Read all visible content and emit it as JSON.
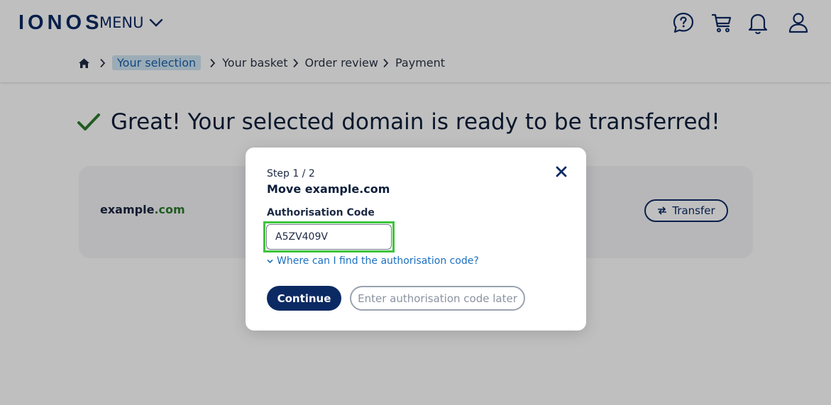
{
  "header": {
    "logo": "IONOS",
    "menu_label": "MENU",
    "icons": [
      "help-chat-icon",
      "cart-icon",
      "bell-icon",
      "user-icon"
    ]
  },
  "breadcrumb": {
    "items": [
      {
        "label": "Your selection",
        "active": true
      },
      {
        "label": "Your basket",
        "active": false
      },
      {
        "label": "Order review",
        "active": false
      },
      {
        "label": "Payment",
        "active": false
      }
    ]
  },
  "page": {
    "title": "Great! Your selected domain is ready to be transferred!"
  },
  "card": {
    "domain_name": "example",
    "domain_tld": ".com",
    "transfer_label": "Transfer"
  },
  "modal": {
    "step": "Step 1 / 2",
    "title": "Move example.com",
    "field_label": "Authorisation Code",
    "code_value": "A5ZV409V",
    "help_link": "Where can I find the authorisation code?",
    "continue_label": "Continue",
    "later_label": "Enter authorisation code later"
  },
  "colors": {
    "brand": "#0b2a63",
    "link": "#1a6fc0",
    "success": "#2c7a2c",
    "highlight": "#3ec43e"
  }
}
